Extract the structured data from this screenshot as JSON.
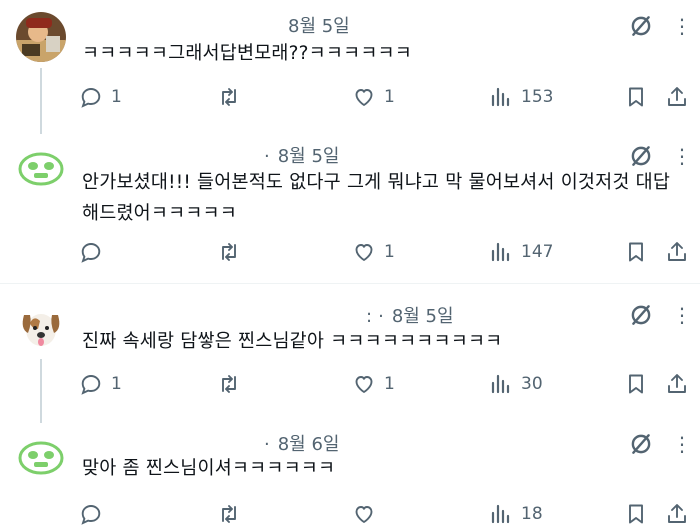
{
  "tweets": [
    {
      "date": "8월 5일",
      "show_dot": false,
      "prefix": "",
      "text": "ㅋㅋㅋㅋㅋ그래서답변모래??ㅋㅋㅋㅋㅋㅋ",
      "replies": "1",
      "reposts": "",
      "likes": "1",
      "views": "153"
    },
    {
      "date": "8월 5일",
      "show_dot": true,
      "prefix": "",
      "text": "안가보셨대!!! 들어본적도 없다구 그게 뭐냐고 막 물어보셔서 이것저것 대답해드렸어ㅋㅋㅋㅋㅋ",
      "replies": "",
      "reposts": "",
      "likes": "1",
      "views": "147"
    },
    {
      "date": "8월 5일",
      "show_dot": true,
      "prefix": ":",
      "text": "진짜 속세랑 담쌓은 찐스님같아 ㅋㅋㅋㅋㅋㅋㅋㅋㅋㅋ",
      "replies": "1",
      "reposts": "",
      "likes": "1",
      "views": "30"
    },
    {
      "date": "8월 6일",
      "show_dot": true,
      "prefix": "",
      "text": "맞아 좀 찐스님이셔ㅋㅋㅋㅋㅋㅋ",
      "replies": "",
      "reposts": "",
      "likes": "",
      "views": "18"
    }
  ],
  "icons": {
    "reply": "reply-icon",
    "repost": "repost-icon",
    "like": "heart-icon",
    "views": "views-icon",
    "bookmark": "bookmark-icon",
    "share": "share-icon",
    "grok": "grok-icon"
  },
  "colors": {
    "text": "#0f1419",
    "secondary": "#536471",
    "thread_line": "#cfd9de",
    "divider": "#eff3f4",
    "green_avatar": "#7dcf6b"
  }
}
